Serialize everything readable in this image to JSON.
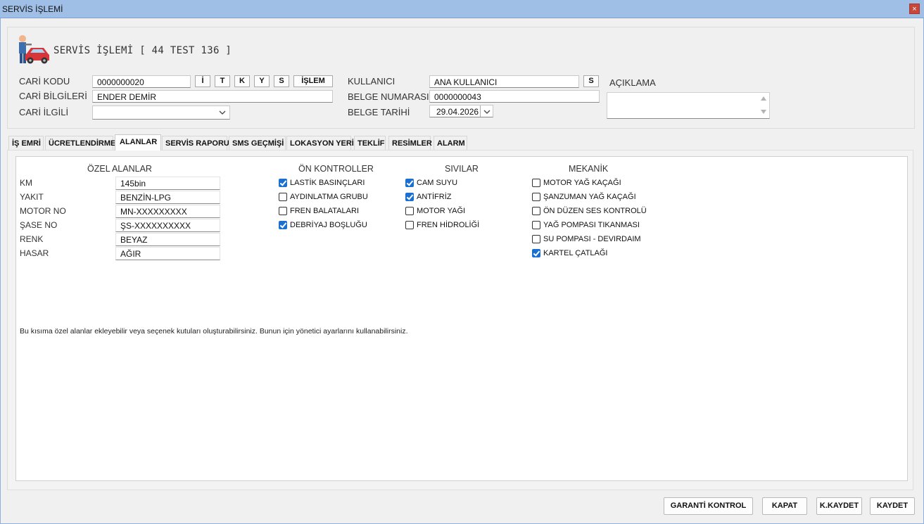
{
  "window": {
    "title": "SERVİS İŞLEMİ",
    "close_symbol": "×"
  },
  "page_title": "SERVİS İŞLEMİ [ 44 TEST 136 ]",
  "header": {
    "cari_kodu_label": "CARİ KODU",
    "cari_kodu_value": "0000000020",
    "quick_buttons": [
      "İ",
      "T",
      "K",
      "Y",
      "S"
    ],
    "islem_button": "İŞLEM",
    "cari_bilgileri_label": "CARİ BİLGİLERİ",
    "cari_bilgileri_value": "ENDER DEMİR",
    "cari_ilgili_label": "CARİ İLGİLİ",
    "cari_ilgili_value": "",
    "kullanici_label": "KULLANICI",
    "kullanici_value": "ANA KULLANICI",
    "kullanici_button": "S",
    "belge_numarasi_label": "BELGE NUMARASI",
    "belge_numarasi_value": "0000000043",
    "belge_tarihi_label": "BELGE TARİHİ",
    "belge_tarihi_value": "29.04.2026",
    "aciklama_label": "AÇIKLAMA",
    "aciklama_value": ""
  },
  "tabs": [
    "İŞ EMRİ",
    "ÜCRETLENDİRME",
    "ALANLAR",
    "SERVİS RAPORU",
    "SMS GEÇMİŞİ",
    "LOKASYON YERİ",
    "TEKLİF",
    "RESİMLER",
    "ALARM"
  ],
  "active_tab": "ALANLAR",
  "ozel_alanlar": {
    "title": "ÖZEL ALANLAR",
    "fields": [
      {
        "label": "KM",
        "value": "145bin"
      },
      {
        "label": "YAKIT",
        "value": "BENZİN-LPG"
      },
      {
        "label": "MOTOR NO",
        "value": "MN-XXXXXXXXX"
      },
      {
        "label": "ŞASE NO",
        "value": "ŞS-XXXXXXXXXX"
      },
      {
        "label": "RENK",
        "value": "BEYAZ"
      },
      {
        "label": "HASAR",
        "value": "AĞIR"
      }
    ]
  },
  "on_kontroller": {
    "title": "ÖN KONTROLLER",
    "items": [
      {
        "label": "LASTİK BASINÇLARI",
        "checked": true
      },
      {
        "label": "AYDINLATMA GRUBU",
        "checked": false
      },
      {
        "label": "FREN BALATALARI",
        "checked": false
      },
      {
        "label": "DEBRİYAJ BOŞLUĞU",
        "checked": true
      }
    ]
  },
  "sivilar": {
    "title": "SIVILAR",
    "items": [
      {
        "label": "CAM SUYU",
        "checked": true
      },
      {
        "label": "ANTİFRİZ",
        "checked": true
      },
      {
        "label": "MOTOR YAĞI",
        "checked": false
      },
      {
        "label": "FREN HİDROLİĞİ",
        "checked": false
      }
    ]
  },
  "mekanik": {
    "title": "MEKANİK",
    "items": [
      {
        "label": "MOTOR YAĞ KAÇAĞI",
        "checked": false
      },
      {
        "label": "ŞANZUMAN YAĞ KAÇAĞI",
        "checked": false
      },
      {
        "label": "ÖN DÜZEN SES KONTROLÜ",
        "checked": false
      },
      {
        "label": "YAĞ POMPASI TIKANMASI",
        "checked": false
      },
      {
        "label": "SU POMPASI - DEVIRDAIM",
        "checked": false
      },
      {
        "label": "KARTEL ÇATLAĞI",
        "checked": true
      }
    ]
  },
  "note": "Bu kısıma özel alanlar ekleyebilir veya seçenek kutuları oluşturabilirsiniz. Bunun için yönetici ayarlarını kullanabilirsiniz.",
  "footer_buttons": {
    "garanti": "GARANTİ KONTROL",
    "kapat": "KAPAT",
    "kkaydet": "K.KAYDET",
    "kaydet": "KAYDET"
  },
  "colors": {
    "titlebar": "#9fbfe6",
    "checkbox_checked": "#1a6fd0",
    "close": "#c8453a"
  }
}
